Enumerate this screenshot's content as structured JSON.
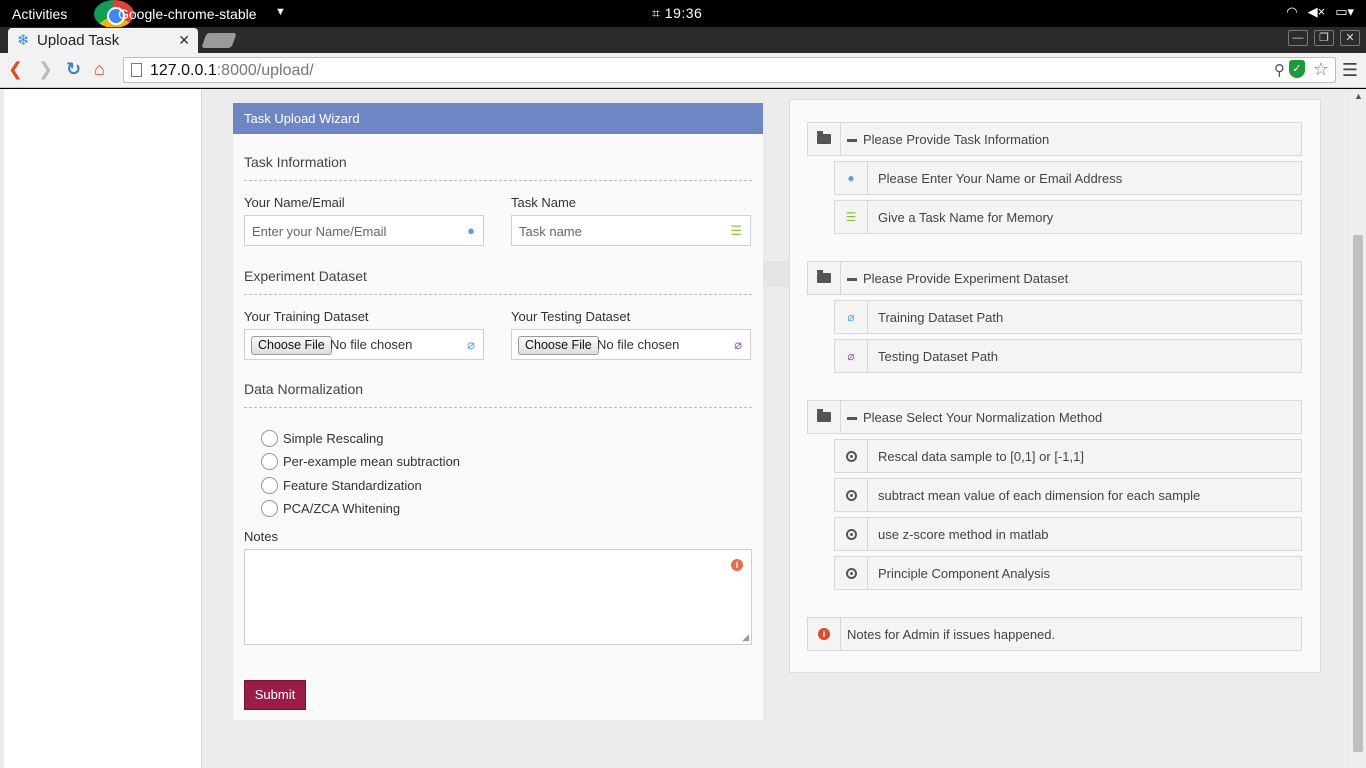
{
  "os": {
    "activities": "Activities",
    "app_name": "Google-chrome-stable",
    "clock_icon": "⌗",
    "time": "19:36"
  },
  "browser": {
    "tab_title": "Upload Task",
    "url_host": "127.0.0.1",
    "url_path": ":8000/upload/"
  },
  "wizard": {
    "header": "Task Upload Wizard",
    "sections": {
      "task_info": "Task Information",
      "dataset": "Experiment Dataset",
      "normalization": "Data Normalization"
    },
    "name_label": "Your Name/Email",
    "name_placeholder": "Enter your Name/Email",
    "task_label": "Task Name",
    "task_placeholder": "Task name",
    "training_label": "Your Training Dataset",
    "testing_label": "Your Testing Dataset",
    "choose_file": "Choose File",
    "no_file": "No file chosen",
    "radios": [
      "Simple Rescaling",
      "Per-example mean subtraction",
      "Feature Standardization",
      "PCA/ZCA Whitening"
    ],
    "notes_label": "Notes",
    "submit": "Submit"
  },
  "help": {
    "group1": "Please Provide Task Information",
    "g1_items": [
      "Please Enter Your Name or Email Address",
      "Give a Task Name for Memory"
    ],
    "group2": "Please Provide Experiment Dataset",
    "g2_items": [
      "Training Dataset Path",
      "Testing Dataset Path"
    ],
    "group3": "Please Select Your Normalization Method",
    "g3_items": [
      "Rescal data sample to [0,1] or [-1,1]",
      "subtract mean value of each dimension for each sample",
      "use z-score method in matlab",
      "Principle Component Analysis"
    ],
    "notes": "Notes for Admin if issues happened."
  },
  "colors": {
    "wizard_header": "#6e87c4",
    "submit": "#9a1c49"
  }
}
